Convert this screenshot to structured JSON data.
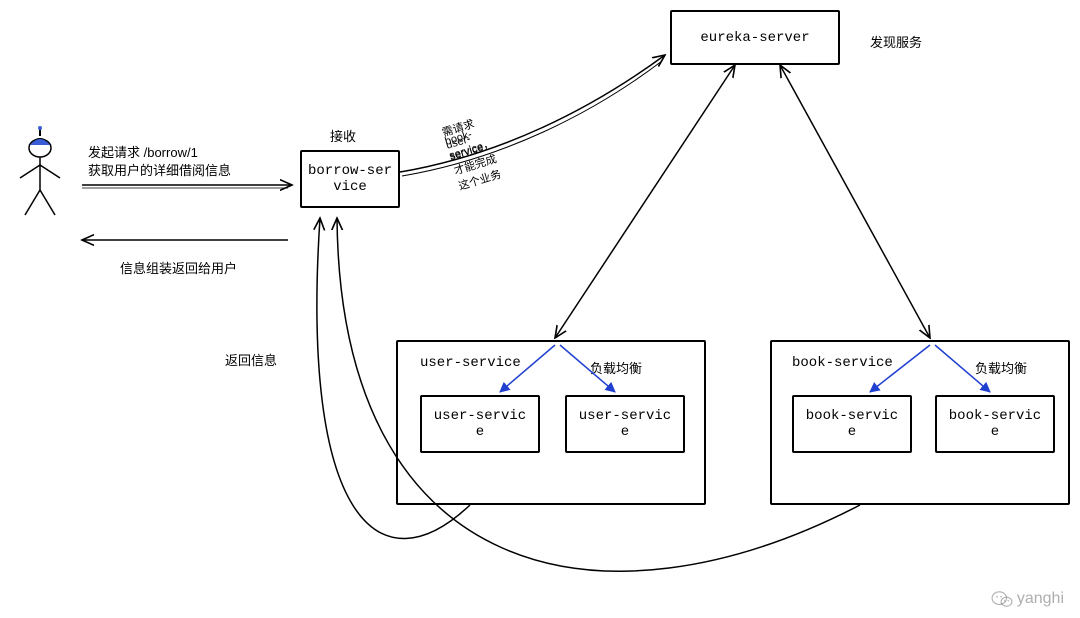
{
  "actor": {
    "name": "stick-figure-user"
  },
  "arrows": {
    "request_label_line1": "发起请求 /borrow/1",
    "request_label_line2": "获取用户的详细借阅信息",
    "receive_label": "接收",
    "response_label": "信息组装返回给用户",
    "need_services_line1": "需请求 user-service",
    "need_services_line2": "book-service，才能完成这个业务",
    "discover_label": "发现服务",
    "return_info_label": "返回信息"
  },
  "nodes": {
    "borrow_service": "borrow-ser\nvice",
    "eureka_server": "eureka-server",
    "user_service_group": "user-service",
    "user_service_lb": "负载均衡",
    "user_service_instance": "user-servic\ne",
    "book_service_group": "book-service",
    "book_service_lb": "负载均衡",
    "book_service_instance": "book-servic\ne"
  },
  "watermark": "yanghi"
}
